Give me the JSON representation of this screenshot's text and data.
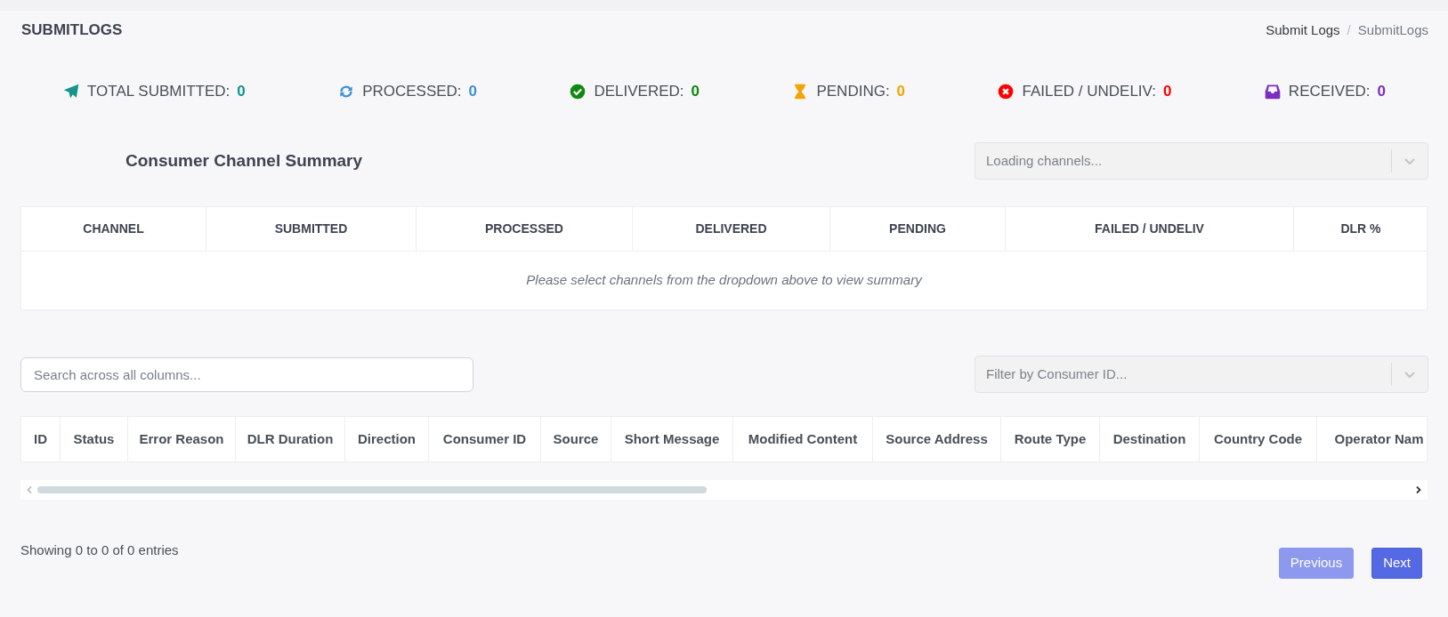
{
  "page_title": "SUBMITLOGS",
  "breadcrumb": [
    {
      "label": "Submit Logs",
      "selected": false
    },
    {
      "label": "SubmitLogs",
      "selected": true
    }
  ],
  "breadcrumb_separator": "/",
  "stats": [
    {
      "label": "TOTAL SUBMITTED:",
      "value": "0",
      "color": "#15958a"
    },
    {
      "label": "PROCESSED:",
      "value": "0",
      "color": "#3f8fd8"
    },
    {
      "label": "DELIVERED:",
      "value": "0",
      "color": "#0f8a0f"
    },
    {
      "label": "PENDING:",
      "value": "0",
      "color": "#f5a300"
    },
    {
      "label": "FAILED / UNDELIV:",
      "value": "0",
      "color": "#ff0000"
    },
    {
      "label": "RECEIVED:",
      "value": "0",
      "color": "#7b2fc0"
    }
  ],
  "channel_summary": {
    "title": "Consumer Channel Summary",
    "channel_select": {
      "placeholder": "Loading channels...",
      "disabled": true
    },
    "columns": [
      "CHANNEL",
      "SUBMITTED",
      "PROCESSED",
      "DELIVERED",
      "PENDING",
      "FAILED / UNDELIV",
      "DLR %"
    ],
    "empty_message": "Please select channels from the dropdown above to view summary"
  },
  "search": {
    "placeholder": "Search across all columns..."
  },
  "consumer_filter": {
    "placeholder": "Filter by Consumer ID...",
    "disabled": true
  },
  "logs_table": {
    "columns": [
      "ID",
      "Status",
      "Error Reason",
      "DLR Duration",
      "Direction",
      "Consumer ID",
      "Source",
      "Short Message",
      "Modified Content",
      "Source Address",
      "Route Type",
      "Destination",
      "Country Code",
      "Operator Nam"
    ]
  },
  "entries_info": "Showing 0 to 0 of 0 entries",
  "pagination": [
    {
      "label": "Previous",
      "disabled": true
    },
    {
      "label": "Next",
      "disabled": false
    }
  ]
}
